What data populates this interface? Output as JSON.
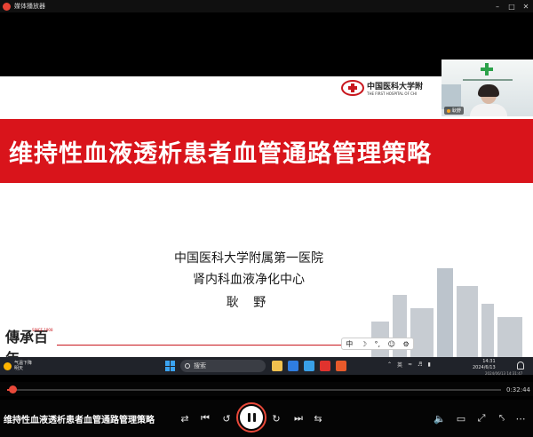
{
  "window": {
    "title": "媒体播放器",
    "controls": [
      "minimize-icon",
      "maximize-icon",
      "close-icon"
    ]
  },
  "slide": {
    "logo_cn": "中国医科大学附",
    "logo_en": "THE FIRST HOSPITAL OF CHI",
    "title": "维持性血液透析患者血管通路管理策略",
    "hospital": "中国医科大学附属第一医院",
    "department": "肾内科血液净化中心",
    "presenter": "耿 野",
    "seal_since": "SINCE 1908",
    "accent_color": "#d9141b"
  },
  "ime_toolbar": {
    "items": [
      "中",
      "☽",
      "°,",
      "☺",
      "⚙"
    ]
  },
  "webcam": {
    "name_label": "耿野"
  },
  "recorded_taskbar": {
    "weather_line1": "气温下降",
    "weather_line2": "明天",
    "search_label": "搜索",
    "tray_lang": "英",
    "time": "14:31",
    "date": "2024/6/13",
    "recording_stamp": "2024/06/13 14:31:47"
  },
  "player": {
    "progress_fraction": 0.01,
    "remaining_time": "0:32:44",
    "media_title": "维持性血液透析患者血管通路管理策略",
    "accent_color": "#e9493a",
    "buttons": {
      "shuffle": "shuffle-icon",
      "previous": "previous-icon",
      "rewind": "rewind-icon",
      "pause": "pause-icon",
      "forward": "forward-icon",
      "next": "next-icon",
      "volume": "volume-icon",
      "cast": "cast-icon",
      "fullscreen": "fullscreen-icon",
      "more": "more-icon"
    }
  }
}
